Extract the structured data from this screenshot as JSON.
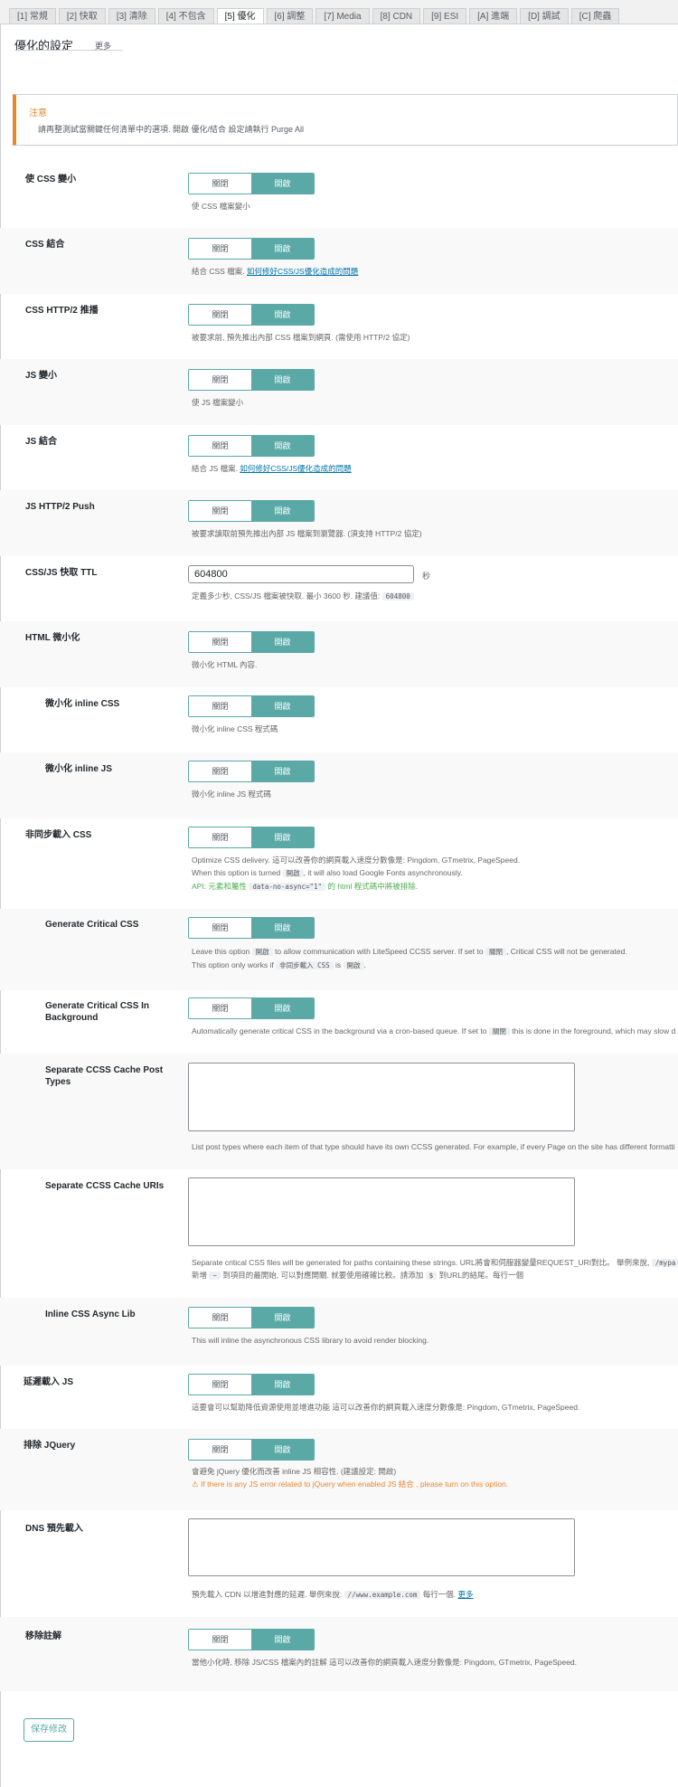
{
  "tabs": [
    "[1] 常規",
    "[2] 快取",
    "[3] 清除",
    "[4] 不包含",
    "[5] 優化",
    "[6] 調整",
    "[7] Media",
    "[8] CDN",
    "[9] ESI",
    "[A] 進端",
    "[D] 調試",
    "[C] 爬蟲"
  ],
  "active_tab": 4,
  "page": {
    "title": "優化的設定",
    "more": "更多"
  },
  "notice": {
    "title": "注意",
    "text": "請再整測試當關鍵任何清單中的選項. 開啟 優化/結合 設定請執行 Purge All"
  },
  "toggle": {
    "off": "關閉",
    "on": "開啟"
  },
  "settings": {
    "css_minify": {
      "label": "使 CSS 變小",
      "desc": "使 CSS 檔案變小"
    },
    "css_combine": {
      "label": "CSS 結合",
      "desc": "結合 CSS 檔案.",
      "link": "如何修好CSS/JS優化造成的問題"
    },
    "css_http2": {
      "label": "CSS HTTP/2 推播",
      "desc": "被要求前, 預先推出內部 CSS 檔案到網頁. (需使用 HTTP/2 協定)"
    },
    "js_minify": {
      "label": "JS 變小",
      "desc": "使 JS 檔案變小"
    },
    "js_combine": {
      "label": "JS 結合",
      "desc": "結合 JS 檔案.",
      "link": "如何修好CSS/JS優化造成的問題"
    },
    "js_http2": {
      "label": "JS HTTP/2 Push",
      "desc": "被要求讀取前預先推出內部 JS 檔案到瀏覽器. (須支持 HTTP/2 協定)"
    },
    "ttl": {
      "label": "CSS/JS 快取 TTL",
      "value": "604800",
      "unit": "秒",
      "desc": "定義多少秒, CSS/JS 檔案被快取. 最小 3600 秒. 建議值:",
      "code": "604800"
    },
    "html_minify": {
      "label": "HTML 微小化",
      "desc": "微小化 HTML 內容."
    },
    "inline_css": {
      "label": "微小化 inline CSS",
      "desc": "微小化 inline CSS 程式碼"
    },
    "inline_js": {
      "label": "微小化 inline JS",
      "desc": "微小化 inline JS 程式碼"
    },
    "async_css": {
      "label": "非同步載入 CSS",
      "desc1": "Optimize CSS delivery. 這可以改善你的網頁載入速度分數像是: Pingdom, GTmetrix, PageSpeed.",
      "desc2a": "When this option is turned",
      "desc2code": "開啟",
      "desc2b": ", it will also load Google Fonts asynchronously.",
      "api_a": "API: 元素和屬性",
      "api_code": "data-no-async=\"1\"",
      "api_b": "的 html 程式碼中將被排除."
    },
    "gen_ccss": {
      "label": "Generate Critical CSS",
      "d1a": "Leave this option",
      "d1code": "開啟",
      "d1b": "to allow communication with LiteSpeed CCSS server. If set to",
      "d1code2": "關閉",
      "d1c": ", Critical CSS will not be generated.",
      "d2a": "This option only works if",
      "d2code": "非同步載入 CSS",
      "d2b": "is",
      "d2code2": "開啟",
      "d2c": "."
    },
    "gen_ccss_bg": {
      "label": "Generate Critical CSS In Background",
      "da": "Automatically generate critical CSS in the background via a cron-based queue. If set to",
      "dcode": "關閉",
      "db": "this is done in the foreground, which may slow d"
    },
    "ccss_post_types": {
      "label": "Separate CCSS Cache Post Types",
      "desc": "List post types where each item of that type should have its own CCSS generated. For example, if every Page on the site has different formatti"
    },
    "ccss_uris": {
      "label": "Separate CCSS Cache URIs",
      "d1a": "Separate critical CSS files will be generated for paths containing these strings. URL將會和伺服器變量REQUEST_URI對比。 舉例來說,",
      "d1code": "/mypa",
      "d2a": "新增",
      "d2code": "~",
      "d2b": "到項目的最開始, 可以對應開關. 就要使用確確比較。請添加",
      "d2code2": "$",
      "d2c": "到URL的結尾。每行一個"
    },
    "inline_async_lib": {
      "label": "Inline CSS Async Lib",
      "desc": "This will inline the asynchronous CSS library to avoid render blocking."
    },
    "defer_js": {
      "label": "延遲載入 JS",
      "desc": "這要會可以幫助降低資源使用並增進功能 這可以改善你的網頁載入速度分數像是: Pingdom, GTmetrix, PageSpeed."
    },
    "exclude_jquery": {
      "label": "排除 JQuery",
      "desc": "會避免 jQuery 優化而改善 inline JS 相容性. (建議設定: 開啟)",
      "warn": "⚠ If there is any JS error related to jQuery when enabled JS 結合 , please turn on this option."
    },
    "dns_prefetch": {
      "label": "DNS 預先載入",
      "da": "預先載入 CDN 以增進對應的延遲. 舉例來說:",
      "dcode": "//www.example.com",
      "db": "每行一個.",
      "dlink": "更多"
    },
    "remove_comments": {
      "label": "移除註解",
      "desc": "當他小化時, 移除 JS/CSS 檔案內的註解 這可以改善你的網頁載入速度分數像是: Pingdom, GTmetrix, PageSpeed."
    }
  },
  "save_button": "保存修改"
}
